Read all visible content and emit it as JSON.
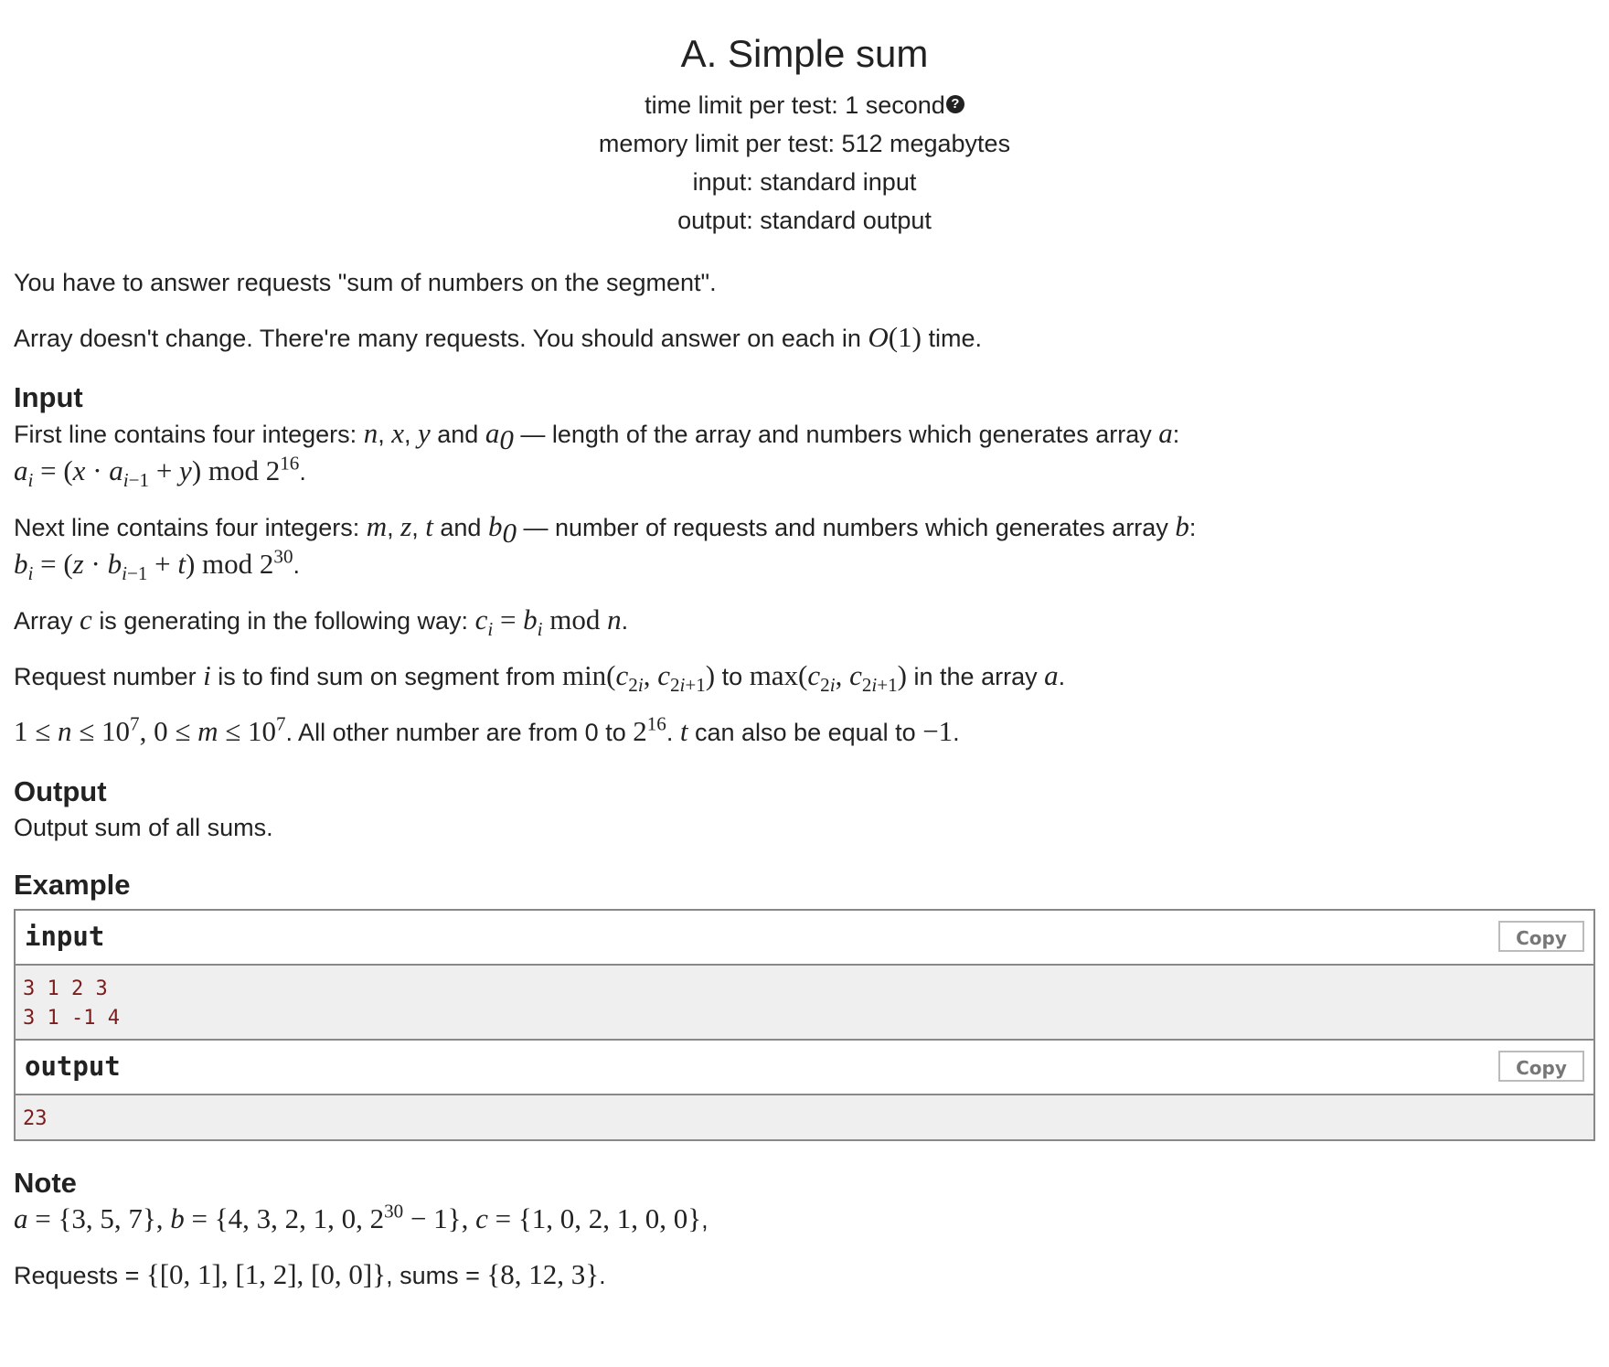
{
  "header": {
    "title": "A. Simple sum",
    "time_limit": "time limit per test: 1 second",
    "memory_limit": "memory limit per test: 512 megabytes",
    "input": "input: standard input",
    "output": "output: standard output"
  },
  "statement": {
    "p1": "You have to answer requests \"sum of numbers on the segment\".",
    "p2_a": "Array doesn't change. There're many requests. You should answer on each in",
    "p2_b": "time.",
    "input_heading": "Input",
    "input_line1_a": "First line contains four integers:",
    "input_line1_and": "and",
    "input_line1_b": "— length of the array and numbers which generates array",
    "next_line_a": "Next line contains four integers:",
    "next_line_and": "and",
    "next_line_b": "— number of requests and numbers which generates array",
    "array_c_a": "Array",
    "array_c_b": "is generating in the following way:",
    "request_a": "Request number",
    "request_b": "is to find sum on segment from",
    "request_to": "to",
    "request_c": "in the array",
    "constraints_a": ". All other number are from 0 to",
    "constraints_b": "can also be equal to",
    "output_heading": "Output",
    "output_text": "Output sum of all sums.",
    "example_heading": "Example",
    "note_heading": "Note",
    "requests_label": "Requests =",
    "sums_label": ", sums ="
  },
  "example": {
    "input_label": "input",
    "output_label": "output",
    "copy_label": "Copy",
    "input_lines": [
      "3 1 2 3",
      "3 1 -1 4"
    ],
    "output_lines": [
      "23"
    ]
  },
  "icons": {
    "help": "help-circle-icon"
  }
}
